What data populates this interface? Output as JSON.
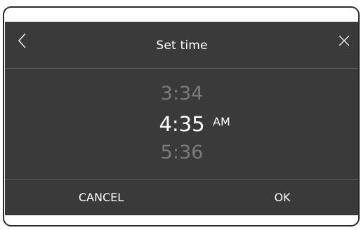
{
  "dialog": {
    "title": "Set time",
    "back_icon": "chevron-left-icon",
    "close_icon": "close-icon"
  },
  "picker": {
    "previous": "3:34",
    "current": "4:35",
    "next": "5:36",
    "period": "AM"
  },
  "actions": {
    "cancel_label": "CANCEL",
    "ok_label": "OK"
  },
  "colors": {
    "dialog_background": "#3a3a3a",
    "text_primary": "#ffffff",
    "text_dimmed": "#7a7a7a",
    "divider": "#5e5e5e"
  }
}
